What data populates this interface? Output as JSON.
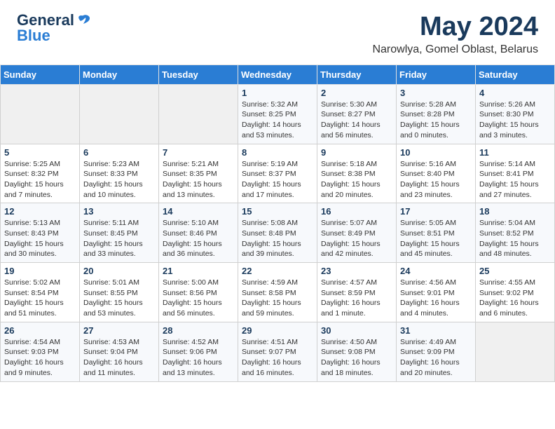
{
  "header": {
    "logo_general": "General",
    "logo_blue": "Blue",
    "title": "May 2024",
    "subtitle": "Narowlya, Gomel Oblast, Belarus"
  },
  "weekdays": [
    "Sunday",
    "Monday",
    "Tuesday",
    "Wednesday",
    "Thursday",
    "Friday",
    "Saturday"
  ],
  "weeks": [
    [
      {
        "day": "",
        "info": ""
      },
      {
        "day": "",
        "info": ""
      },
      {
        "day": "",
        "info": ""
      },
      {
        "day": "1",
        "info": "Sunrise: 5:32 AM\nSunset: 8:25 PM\nDaylight: 14 hours and 53 minutes."
      },
      {
        "day": "2",
        "info": "Sunrise: 5:30 AM\nSunset: 8:27 PM\nDaylight: 14 hours and 56 minutes."
      },
      {
        "day": "3",
        "info": "Sunrise: 5:28 AM\nSunset: 8:28 PM\nDaylight: 15 hours and 0 minutes."
      },
      {
        "day": "4",
        "info": "Sunrise: 5:26 AM\nSunset: 8:30 PM\nDaylight: 15 hours and 3 minutes."
      }
    ],
    [
      {
        "day": "5",
        "info": "Sunrise: 5:25 AM\nSunset: 8:32 PM\nDaylight: 15 hours and 7 minutes."
      },
      {
        "day": "6",
        "info": "Sunrise: 5:23 AM\nSunset: 8:33 PM\nDaylight: 15 hours and 10 minutes."
      },
      {
        "day": "7",
        "info": "Sunrise: 5:21 AM\nSunset: 8:35 PM\nDaylight: 15 hours and 13 minutes."
      },
      {
        "day": "8",
        "info": "Sunrise: 5:19 AM\nSunset: 8:37 PM\nDaylight: 15 hours and 17 minutes."
      },
      {
        "day": "9",
        "info": "Sunrise: 5:18 AM\nSunset: 8:38 PM\nDaylight: 15 hours and 20 minutes."
      },
      {
        "day": "10",
        "info": "Sunrise: 5:16 AM\nSunset: 8:40 PM\nDaylight: 15 hours and 23 minutes."
      },
      {
        "day": "11",
        "info": "Sunrise: 5:14 AM\nSunset: 8:41 PM\nDaylight: 15 hours and 27 minutes."
      }
    ],
    [
      {
        "day": "12",
        "info": "Sunrise: 5:13 AM\nSunset: 8:43 PM\nDaylight: 15 hours and 30 minutes."
      },
      {
        "day": "13",
        "info": "Sunrise: 5:11 AM\nSunset: 8:45 PM\nDaylight: 15 hours and 33 minutes."
      },
      {
        "day": "14",
        "info": "Sunrise: 5:10 AM\nSunset: 8:46 PM\nDaylight: 15 hours and 36 minutes."
      },
      {
        "day": "15",
        "info": "Sunrise: 5:08 AM\nSunset: 8:48 PM\nDaylight: 15 hours and 39 minutes."
      },
      {
        "day": "16",
        "info": "Sunrise: 5:07 AM\nSunset: 8:49 PM\nDaylight: 15 hours and 42 minutes."
      },
      {
        "day": "17",
        "info": "Sunrise: 5:05 AM\nSunset: 8:51 PM\nDaylight: 15 hours and 45 minutes."
      },
      {
        "day": "18",
        "info": "Sunrise: 5:04 AM\nSunset: 8:52 PM\nDaylight: 15 hours and 48 minutes."
      }
    ],
    [
      {
        "day": "19",
        "info": "Sunrise: 5:02 AM\nSunset: 8:54 PM\nDaylight: 15 hours and 51 minutes."
      },
      {
        "day": "20",
        "info": "Sunrise: 5:01 AM\nSunset: 8:55 PM\nDaylight: 15 hours and 53 minutes."
      },
      {
        "day": "21",
        "info": "Sunrise: 5:00 AM\nSunset: 8:56 PM\nDaylight: 15 hours and 56 minutes."
      },
      {
        "day": "22",
        "info": "Sunrise: 4:59 AM\nSunset: 8:58 PM\nDaylight: 15 hours and 59 minutes."
      },
      {
        "day": "23",
        "info": "Sunrise: 4:57 AM\nSunset: 8:59 PM\nDaylight: 16 hours and 1 minute."
      },
      {
        "day": "24",
        "info": "Sunrise: 4:56 AM\nSunset: 9:01 PM\nDaylight: 16 hours and 4 minutes."
      },
      {
        "day": "25",
        "info": "Sunrise: 4:55 AM\nSunset: 9:02 PM\nDaylight: 16 hours and 6 minutes."
      }
    ],
    [
      {
        "day": "26",
        "info": "Sunrise: 4:54 AM\nSunset: 9:03 PM\nDaylight: 16 hours and 9 minutes."
      },
      {
        "day": "27",
        "info": "Sunrise: 4:53 AM\nSunset: 9:04 PM\nDaylight: 16 hours and 11 minutes."
      },
      {
        "day": "28",
        "info": "Sunrise: 4:52 AM\nSunset: 9:06 PM\nDaylight: 16 hours and 13 minutes."
      },
      {
        "day": "29",
        "info": "Sunrise: 4:51 AM\nSunset: 9:07 PM\nDaylight: 16 hours and 16 minutes."
      },
      {
        "day": "30",
        "info": "Sunrise: 4:50 AM\nSunset: 9:08 PM\nDaylight: 16 hours and 18 minutes."
      },
      {
        "day": "31",
        "info": "Sunrise: 4:49 AM\nSunset: 9:09 PM\nDaylight: 16 hours and 20 minutes."
      },
      {
        "day": "",
        "info": ""
      }
    ]
  ]
}
